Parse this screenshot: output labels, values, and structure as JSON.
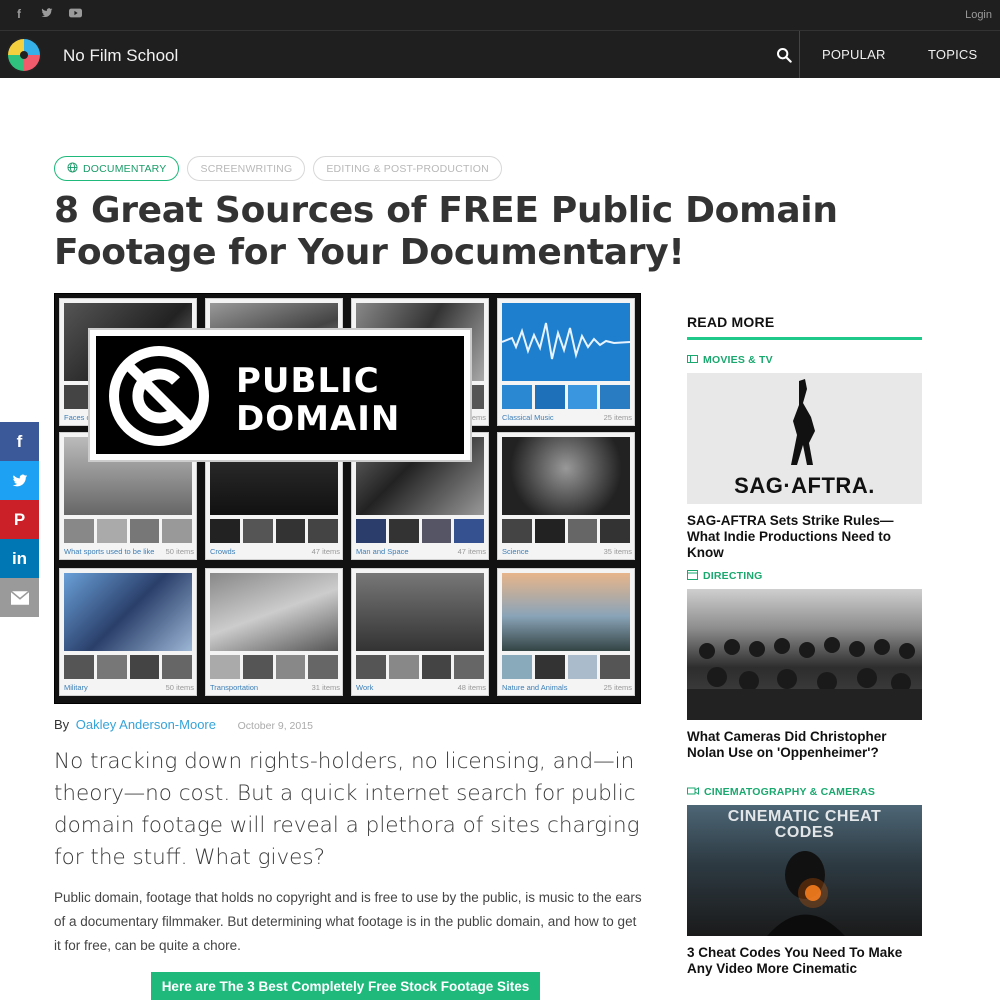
{
  "topbar": {
    "social_icons": [
      "facebook-icon",
      "twitter-icon",
      "youtube-icon"
    ],
    "login_label": "Login"
  },
  "header": {
    "site_title": "No Film School",
    "nav": [
      "POPULAR",
      "TOPICS"
    ]
  },
  "tags": [
    "DOCUMENTARY",
    "SCREENWRITING",
    "EDITING & POST-PRODUCTION"
  ],
  "article": {
    "headline": "8 Great Sources of FREE Public Domain Footage for Your Documentary!",
    "hero": {
      "banner_line1": "PUBLIC",
      "banner_line2": "DOMAIN",
      "tiles": [
        {
          "caption": "Faces o",
          "count": ""
        },
        {
          "caption": "",
          "count": ""
        },
        {
          "caption": "",
          "count": "ems"
        },
        {
          "caption": "Classical Music",
          "count": "25 items"
        },
        {
          "caption": "What sports used to be like",
          "count": "50 items"
        },
        {
          "caption": "Crowds",
          "count": "47 items"
        },
        {
          "caption": "Man and Space",
          "count": "47 items"
        },
        {
          "caption": "Science",
          "count": "35 items"
        },
        {
          "caption": "Military",
          "count": "50 items"
        },
        {
          "caption": "Transportation",
          "count": "31 items"
        },
        {
          "caption": "Work",
          "count": "48 items"
        },
        {
          "caption": "Nature and Animals",
          "count": "25 items"
        }
      ]
    },
    "byline_prefix": "By",
    "author": "Oakley Anderson-Moore",
    "date": "October 9, 2015",
    "lede": "No tracking down rights-holders, no licensing, and—in theory—no cost. But a quick internet search for public domain footage will reveal a plethora of sites charging for the stuff. What gives?",
    "body": "Public domain, footage that holds no copyright and is free to use by the public, is music to the ears of a documentary filmmaker. But determining what footage is in the public domain, and how to get it for free, can be quite a chore.",
    "cta": "Here are The 3 Best Completely Free Stock Footage Sites"
  },
  "share": [
    {
      "icon": "facebook-icon",
      "glyph": "f",
      "color": "#3b5998"
    },
    {
      "icon": "twitter-icon",
      "glyph": "t",
      "color": "#1da1f2"
    },
    {
      "icon": "pinterest-icon",
      "glyph": "P",
      "color": "#cb2027"
    },
    {
      "icon": "linkedin-icon",
      "glyph": "in",
      "color": "#0077b5"
    },
    {
      "icon": "email-icon",
      "glyph": "✉",
      "color": "#9a9a9a"
    }
  ],
  "sidebar": {
    "heading": "READ MORE",
    "cards": [
      {
        "category": "MOVIES & TV",
        "title": "SAG-AFTRA Sets Strike Rules—What Indie Productions Need to Know",
        "image_text": "SAG·AFTRA."
      },
      {
        "category": "DIRECTING",
        "title": "What Cameras Did Christopher Nolan Use on 'Oppenheimer'?",
        "image_text": ""
      },
      {
        "category": "CINEMATOGRAPHY & CAMERAS",
        "title": "3 Cheat Codes You Need To Make Any Video More Cinematic",
        "image_text": "CINEMATIC CHEAT CODES"
      }
    ]
  },
  "colors": {
    "accent": "#1fb97c",
    "link": "#36a3d9",
    "header_bg": "#1f1f1f"
  }
}
